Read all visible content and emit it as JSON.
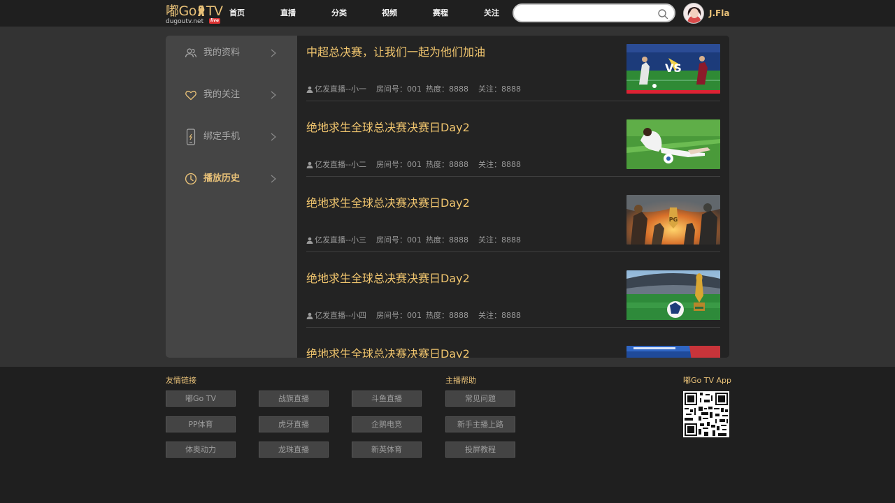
{
  "header": {
    "logo_text": "嘟Go",
    "logo_tv": "TV",
    "logo_domain": "dugoutv.net",
    "logo_badge": "live",
    "nav": [
      "首页",
      "直播",
      "分类",
      "视频",
      "赛程",
      "关注"
    ],
    "search_placeholder": "",
    "username": "J.Fla"
  },
  "sidebar": {
    "items": [
      {
        "label": "我的资料",
        "icon": "profile-icon",
        "active": false
      },
      {
        "label": "我的关注",
        "icon": "heart-icon",
        "active": false
      },
      {
        "label": "绑定手机",
        "icon": "phone-icon",
        "active": false
      },
      {
        "label": "播放历史",
        "icon": "clock-icon",
        "active": true
      }
    ]
  },
  "history": {
    "items": [
      {
        "title": "中超总决赛，让我们一起为他们加油",
        "streamer": "亿发直播--小一",
        "room": "房间号：001",
        "heat": "热度：8888",
        "follow": "关注：8888",
        "thumb": "soccer-vs-thumbnail"
      },
      {
        "title": "绝地求生全球总决赛决赛日Day2",
        "streamer": "亿发直播--小二",
        "room": "房间号：001",
        "heat": "热度：8888",
        "follow": "关注：8888",
        "thumb": "girl-soccer-thumbnail"
      },
      {
        "title": "绝地求生全球总决赛决赛日Day2",
        "streamer": "亿发直播--小三",
        "room": "房间号：001",
        "heat": "热度：8888",
        "follow": "关注：8888",
        "thumb": "pubg-thumbnail"
      },
      {
        "title": "绝地求生全球总决赛决赛日Day2",
        "streamer": "亿发直播--小四",
        "room": "房间号：001",
        "heat": "热度：8888",
        "follow": "关注：8888",
        "thumb": "world-cup-thumbnail"
      },
      {
        "title": "绝地求生全球总决赛决赛日Day2",
        "streamer": "",
        "room": "",
        "heat": "",
        "follow": "",
        "thumb": "esports-thumbnail"
      }
    ]
  },
  "footer": {
    "links_title": "友情链接",
    "links": [
      "嘟Go TV",
      "战旗直播",
      "斗鱼直播",
      "PP体育",
      "虎牙直播",
      "企鹅电竞",
      "体奥动力",
      "龙珠直播",
      "新英体育"
    ],
    "help_title": "主播帮助",
    "help": [
      "常见问题",
      "新手主播上路",
      "投屏教程"
    ],
    "app_title": "嘟Go TV App"
  },
  "colors": {
    "accent": "#e8c178",
    "title": "#f0c56e",
    "header_bg": "#1f1f1f",
    "page_bg": "#333333",
    "sidebar_bg": "#454545",
    "list_bg": "#232323"
  }
}
